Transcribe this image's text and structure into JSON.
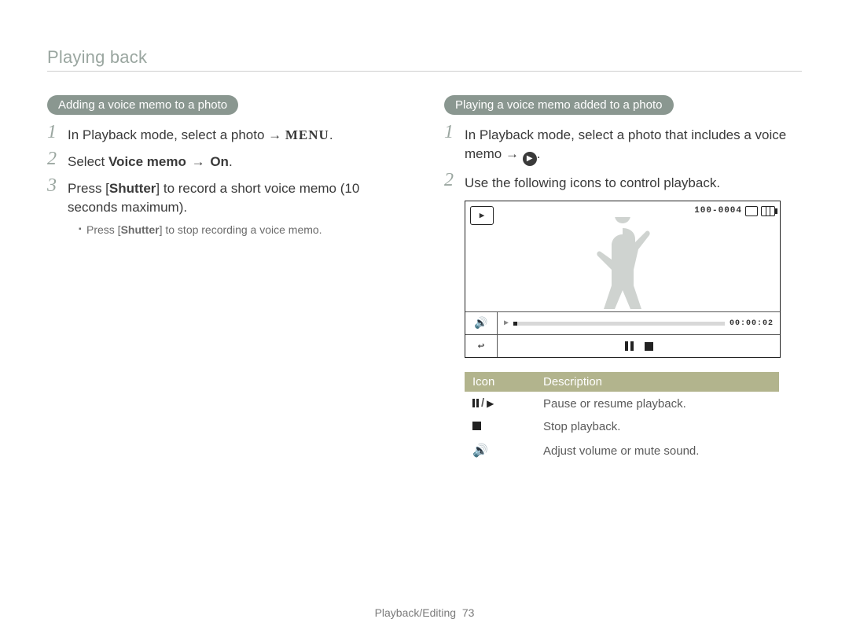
{
  "header": {
    "section": "Playing back"
  },
  "footer": {
    "chapter": "Playback/Editing",
    "page": "73"
  },
  "left": {
    "pill": "Adding a voice memo to a photo",
    "step1_pre": "In Playback mode, select a photo → ",
    "step1_menu": "MENU",
    "step1_post": ".",
    "step2_pre": "Select ",
    "step2_bold": "Voice memo",
    "step2_mid": " → ",
    "step2_bold2": "On",
    "step2_post": ".",
    "step3_pre": "Press [",
    "step3_bold": "Shutter",
    "step3_post": "] to record a short voice memo (10 seconds maximum).",
    "sub1_pre": "Press [",
    "sub1_bold": "Shutter",
    "sub1_post": "] to stop recording a voice memo."
  },
  "right": {
    "pill": "Playing a voice memo added to a photo",
    "step1_pre": "In Playback mode, select a photo that includes a voice memo → ",
    "step1_post": ".",
    "step2": "Use the following icons to control playback.",
    "lcd": {
      "file_no": "100-0004",
      "time": "00:00:02"
    },
    "table": {
      "head_icon": "Icon",
      "head_desc": "Description",
      "row1_desc": "Pause or resume playback.",
      "row2_desc": "Stop playback.",
      "row3_desc": "Adjust volume or mute sound."
    }
  }
}
